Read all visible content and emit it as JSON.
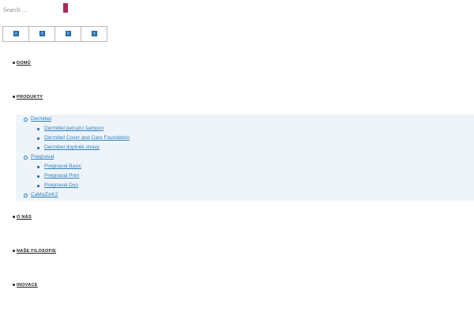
{
  "search": {
    "placeholder": "Search …",
    "button_color": "#b0265a"
  },
  "languages": {
    "items": [
      {
        "icon": "flag-icon",
        "glyph": "?"
      },
      {
        "icon": "flag-icon",
        "glyph": "?"
      },
      {
        "icon": "flag-icon",
        "glyph": "?"
      },
      {
        "icon": "flag-icon",
        "glyph": "?"
      }
    ]
  },
  "menu": {
    "items": [
      {
        "label": "DOMŮ"
      },
      {
        "label": "PRODUKTY"
      },
      {
        "label": "O NÁS"
      },
      {
        "label": "NAŠE FILOSOFIE"
      },
      {
        "label": "INOVACE"
      }
    ],
    "products_submenu": [
      {
        "label": "Dermibel",
        "children": [
          {
            "label": "Dermibel pečující šampon"
          },
          {
            "label": "Dermibel Cover and Care Foundation"
          },
          {
            "label": "Dermibel doplněk stravy"
          }
        ]
      },
      {
        "label": "Pregnaval",
        "children": [
          {
            "label": "Pregnaval Basic"
          },
          {
            "label": "Pregnaval Prim"
          },
          {
            "label": "Pregnaval Duo"
          }
        ]
      },
      {
        "label": "CaMaZinK2",
        "children": []
      }
    ],
    "submenu_background": "#eef4fa",
    "link_color": "#2f7fbf"
  }
}
